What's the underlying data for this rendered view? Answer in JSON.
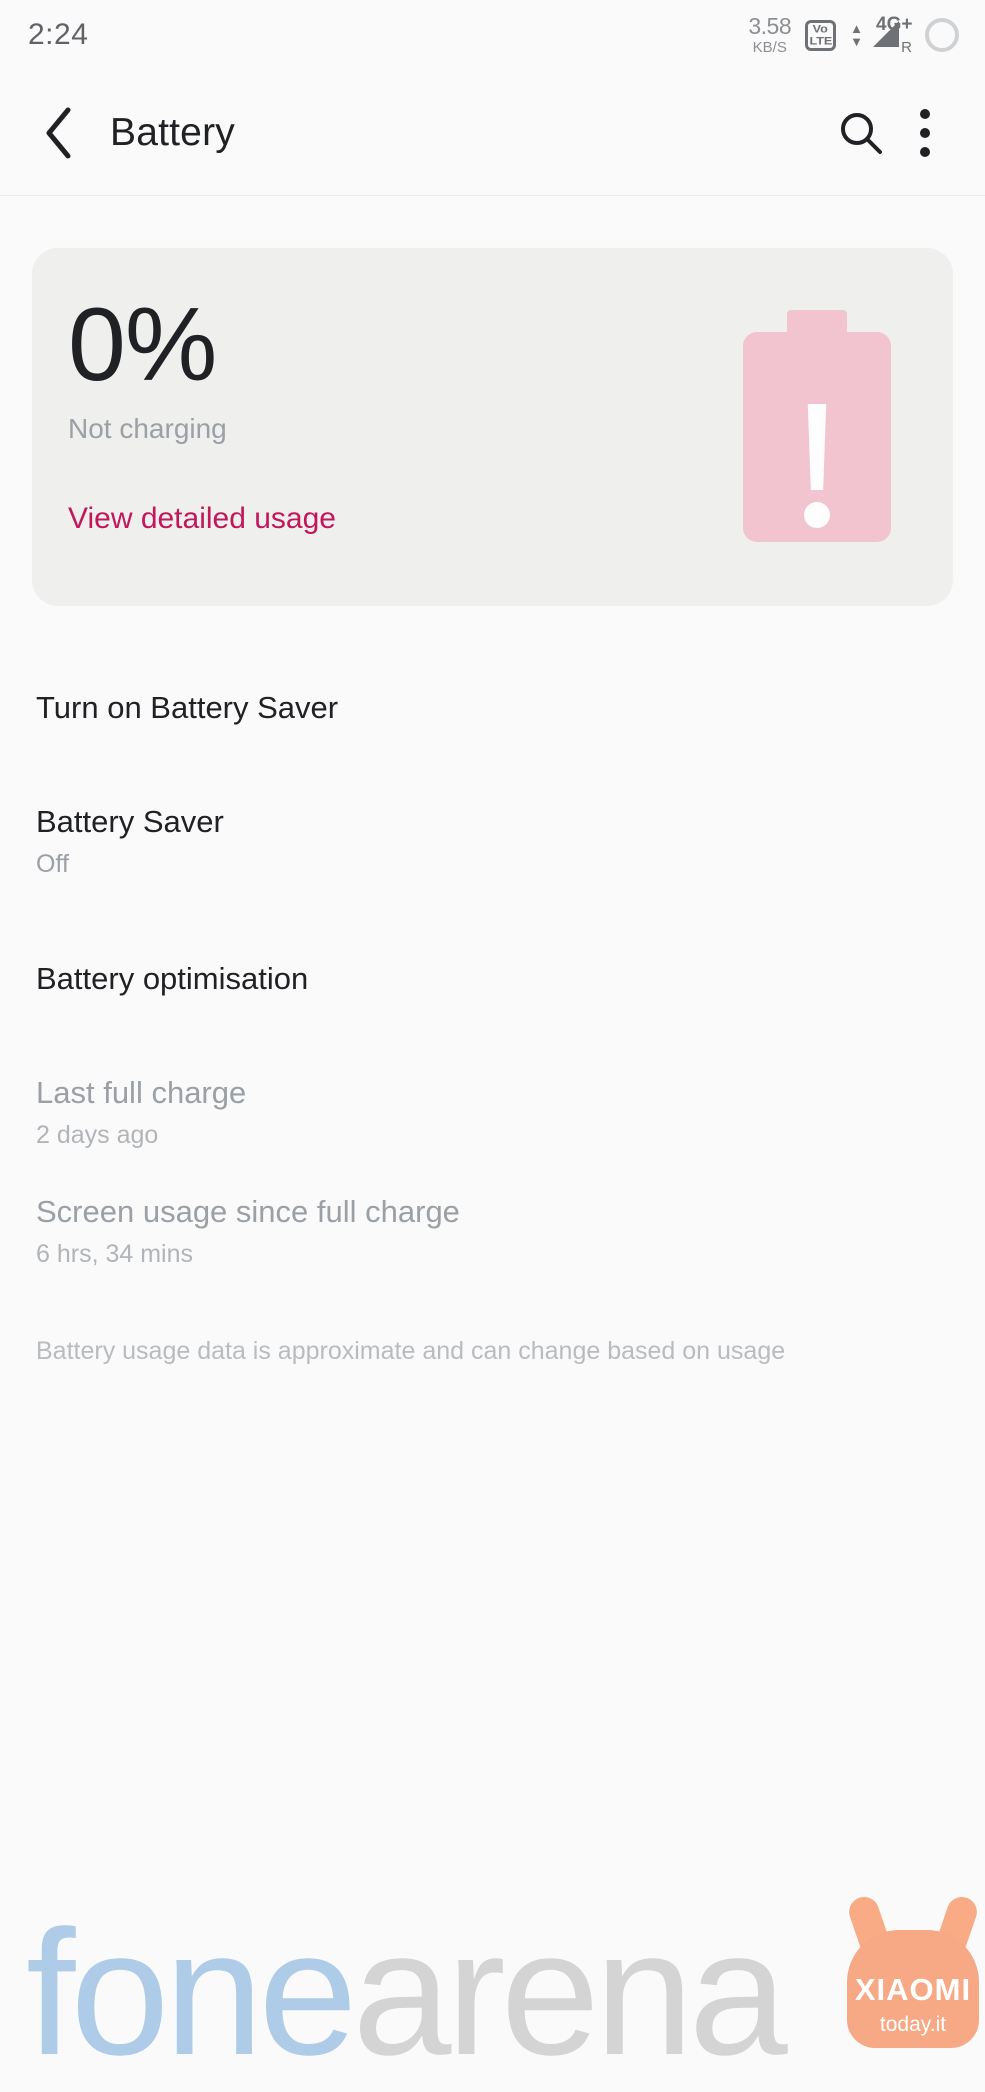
{
  "statusbar": {
    "time": "2:24",
    "net_speed_value": "3.58",
    "net_speed_unit": "KB/S",
    "volte_top": "Vo",
    "volte_bottom": "LTE",
    "arrow_up": "▲",
    "arrow_down": "▼",
    "network_type": "4G+",
    "roaming": "R",
    "battery_icon": "battery-empty-circle-icon"
  },
  "toolbar": {
    "back_icon": "chevron-left-icon",
    "title": "Battery",
    "search_icon": "search-icon",
    "overflow_icon": "more-vertical-icon"
  },
  "battery_card": {
    "percent": "0%",
    "charge_state": "Not charging",
    "detail_link": "View detailed usage",
    "graphic_icon": "battery-alert-icon",
    "graphic_color": "#f2c4cf",
    "card_color": "#efefee",
    "link_color": "#c2185b"
  },
  "list": [
    {
      "title": "Turn on Battery Saver",
      "sub": "",
      "dim": false
    },
    {
      "title": "Battery Saver",
      "sub": "Off",
      "dim": false
    },
    {
      "title": "Battery optimisation",
      "sub": "",
      "dim": false
    },
    {
      "title": "Last full charge",
      "sub": "2 days ago",
      "dim": true
    },
    {
      "title": "Screen usage since full charge",
      "sub": "6 hrs, 34 mins",
      "dim": true
    }
  ],
  "footnote": "Battery usage data is approximate and can change based on usage",
  "watermark": {
    "part_a": "fone",
    "part_b": "arena",
    "color_a": "#aecbe8",
    "color_b": "#d4d4d4",
    "mascot_brand": "XIAOMI",
    "mascot_site": "today.it",
    "mascot_color": "#f7a884"
  }
}
